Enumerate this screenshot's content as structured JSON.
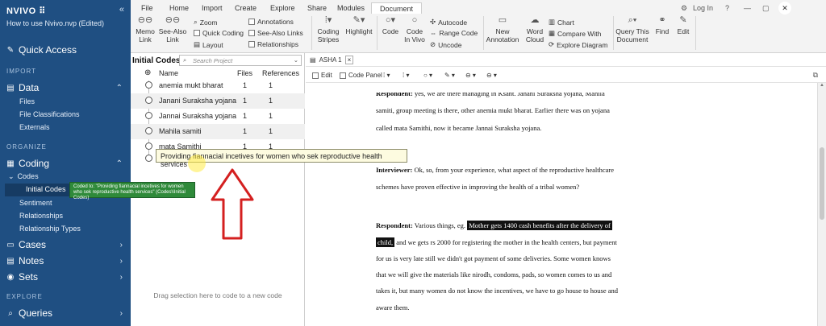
{
  "nav": {
    "brand": "NVIVO ⠿",
    "collapse_glyph": "«",
    "project": "How to use Nvivo.nvp (Edited)",
    "quick_access": "Quick Access",
    "import_section": "IMPORT",
    "data_group": "Data",
    "data_items": [
      "Files",
      "File Classifications",
      "Externals"
    ],
    "organize_section": "ORGANIZE",
    "coding_group": "Coding",
    "codes_label": "Codes",
    "initial_codes": "Initial Codes",
    "coding_items": [
      "Sentiment",
      "Relationships",
      "Relationship Types"
    ],
    "cases_group": "Cases",
    "notes_group": "Notes",
    "sets_group": "Sets",
    "explore_section": "EXPLORE",
    "queries_group": "Queries",
    "coded_tooltip": "Coded to: \"Providing fiannacial incetives for women who sek reproductive health services\" (Codes\\\\Initial Codes)"
  },
  "ribbon": {
    "tabs": [
      "File",
      "Home",
      "Import",
      "Create",
      "Explore",
      "Share",
      "Modules",
      "Document"
    ],
    "selected_tab": "Document",
    "login": "Log In",
    "tools": {
      "memo_link": [
        "Memo",
        "Link"
      ],
      "see_also_link": [
        "See-Also",
        "Link"
      ],
      "zoom": "Zoom",
      "quick_coding": "Quick Coding",
      "layout": "Layout",
      "annotations": "Annotations",
      "see_also_links": "See-Also Links",
      "relationships": "Relationships",
      "coding_stripes": [
        "Coding",
        "Stripes"
      ],
      "highlight": "Highlight",
      "code": "Code",
      "code_in_vivo": [
        "Code",
        "In Vivo"
      ],
      "autocode": "Autocode",
      "range_code": "Range Code",
      "uncode": "Uncode",
      "new_annotation": [
        "New",
        "Annotation"
      ],
      "word_cloud": [
        "Word",
        "Cloud"
      ],
      "chart": "Chart",
      "compare_with": "Compare With",
      "explore_diagram": "Explore Diagram",
      "query_this_document": [
        "Query This",
        "Document"
      ],
      "find": "Find",
      "edit": "Edit"
    }
  },
  "codes_panel": {
    "title": "Initial Codes",
    "search_placeholder": "Search Project",
    "columns": {
      "name": "Name",
      "files": "Files",
      "references": "References"
    },
    "rows": [
      {
        "name": "anemia mukt bharat",
        "files": "1",
        "references": "1"
      },
      {
        "name": "Janani Suraksha yojana",
        "files": "1",
        "references": "1"
      },
      {
        "name": "Jannai Suraksha yojana",
        "files": "1",
        "references": "1"
      },
      {
        "name": "Mahila samiti",
        "files": "1",
        "references": "1"
      },
      {
        "name": "mata Samithi",
        "files": "1",
        "references": "1"
      }
    ],
    "tooltip": "Providing  fiannacial incetives for women who sek reproductive health services",
    "drag_hint": "Drag selection here to code to a new code"
  },
  "document": {
    "tab_label": "ASHA 1",
    "toolbar": {
      "edit": "Edit",
      "code_panel": "Code Panel"
    },
    "lines": {
      "l0_label": "Respondent:",
      "l0": " yes, we are there managing in Ksant. Janani Suraksha yojana, Mahila",
      "l1": "samiti, group meeting is there, other anemia mukt bharat. Earlier there was on yojana",
      "l2": "called mata Samithi, now it became Jannai Suraksha yojana.",
      "l3_label": "Interviewer:",
      "l3": " Ok, so, from your experience, what aspect of the reproductive healthcare",
      "l4": "schemes have proven effective in improving the health of a tribal women?",
      "l5_label": "Respondent:",
      "l5_pre": " Various things, eg. ",
      "l5_sel": "Mother gets 1400 cash benefits after the delivery of",
      "l6_sel": "child,",
      "l6": " and we gets rs 2000 for registering the mother in the health centers, but payment",
      "l7": "for us is very late still we didn't got payment of some deliveries. Some women knows",
      "l8": "that we will give the materials like nirodh, condoms, pads, so women comes to us and",
      "l9": "takes it, but many women do not know the incentives, we have to go house to house and",
      "l10": "aware them."
    }
  },
  "colors": {
    "nav_bg": "#1f4f82",
    "nav_active": "#163b63",
    "green_tooltip": "#2f8a3a",
    "arrow": "#d42020",
    "selection_bg": "#111111"
  }
}
